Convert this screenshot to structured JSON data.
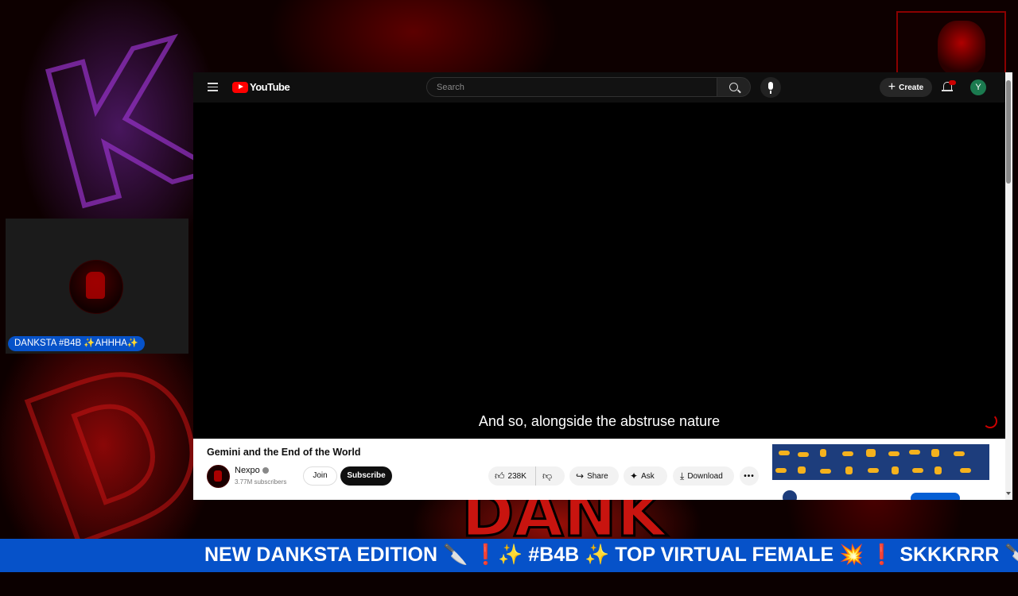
{
  "stream": {
    "background_text": "DANK",
    "webcam_label": "DANKSTA #B4B ✨AHHHA✨",
    "ticker_text": "NEW DANKSTA EDITION 🔪 ❗✨ #B4B ✨ TOP VIRTUAL FEMALE 💥 ❗ SKKKRRR 🔪"
  },
  "youtube": {
    "logo_text": "YouTube",
    "search": {
      "placeholder": "Search",
      "value": ""
    },
    "create_label": "Create",
    "avatar_letter": "Y",
    "caption": "And so, alongside the abstruse nature",
    "video": {
      "title": "Gemini and the End of the World",
      "channel": "Nexpo",
      "subscribers": "3.77M subscribers",
      "join_label": "Join",
      "subscribe_label": "Subscribe",
      "likes": "238K",
      "share_label": "Share",
      "ask_label": "Ask",
      "download_label": "Download",
      "more_label": "•••"
    }
  },
  "colors": {
    "yt_red": "#ff0000",
    "stream_blue": "#0652c9",
    "topbar": "#0f0f0f"
  },
  "icons": [
    "menu-icon",
    "youtube-logo-icon",
    "search-icon",
    "mic-icon",
    "plus-icon",
    "bell-icon",
    "like-icon",
    "dislike-icon",
    "share-icon",
    "ask-sparkle-icon",
    "download-icon",
    "more-icon"
  ]
}
